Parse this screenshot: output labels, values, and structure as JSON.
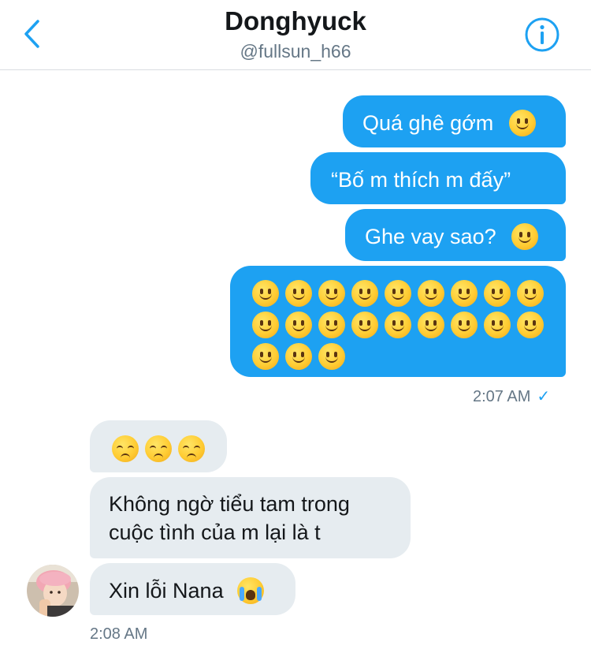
{
  "header": {
    "name": "Donghyuck",
    "handle": "@fullsun_h66"
  },
  "messages_out": [
    {
      "text": "Quá ghê gớm",
      "emoji": "slightly-smiling-face"
    },
    {
      "text": "“Bố m thích m đấy”"
    },
    {
      "text": "Ghe vay sao?",
      "emoji": "slightly-smiling-face"
    },
    {
      "emoji": "slightly-smiling-face",
      "emoji_count": 21
    }
  ],
  "out_time": "2:07 AM",
  "out_status_icon": "✓",
  "messages_in": [
    {
      "emoji": "pensive-face",
      "emoji_count": 3
    },
    {
      "line1": "Không ngờ tiểu tam trong",
      "line2": "cuộc tình của m lại là t"
    },
    {
      "text": "Xin lỗi Nana",
      "emoji": "loudly-crying-face"
    }
  ],
  "in_time": "2:08 AM",
  "colors": {
    "accent": "#1da1f2",
    "incoming_bg": "#e6ecf0",
    "text": "#14171a",
    "muted": "#657786"
  }
}
